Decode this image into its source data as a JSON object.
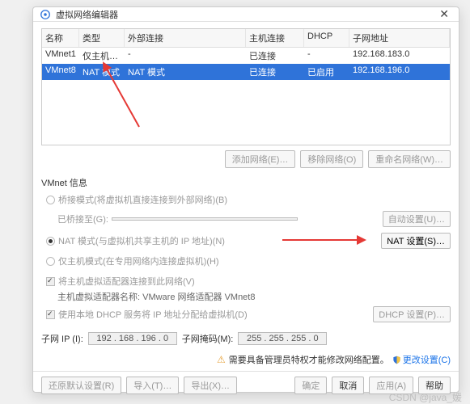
{
  "window": {
    "title": "虚拟网络编辑器"
  },
  "table": {
    "headers": {
      "name": "名称",
      "type": "类型",
      "ext": "外部连接",
      "host": "主机连接",
      "dhcp": "DHCP",
      "subnet": "子网地址"
    },
    "rows": [
      {
        "name": "VMnet1",
        "type": "仅主机…",
        "ext": "-",
        "host": "已连接",
        "dhcp": "-",
        "subnet": "192.168.183.0",
        "selected": false
      },
      {
        "name": "VMnet8",
        "type": "NAT 模式",
        "ext": "NAT 模式",
        "host": "已连接",
        "dhcp": "已启用",
        "subnet": "192.168.196.0",
        "selected": true
      }
    ]
  },
  "buttons": {
    "add_net": "添加网络(E)…",
    "remove_net": "移除网络(O)",
    "rename_net": "重命名网络(W)…",
    "auto_settings": "自动设置(U)…",
    "nat_settings": "NAT 设置(S)…",
    "dhcp_settings": "DHCP 设置(P)…",
    "restore": "还原默认设置(R)",
    "import": "导入(T)…",
    "export": "导出(X)…",
    "ok": "确定",
    "cancel": "取消",
    "apply": "应用(A)",
    "help": "帮助",
    "change_settings": "更改设置(C)"
  },
  "vmnet_info": {
    "title": "VMnet 信息",
    "bridge": "桥接模式(将虚拟机直接连接到外部网络)(B)",
    "bridge_to_label": "已桥接至(G):",
    "nat": "NAT 模式(与虚拟机共享主机的 IP 地址)(N)",
    "hostonly": "仅主机模式(在专用网络内连接虚拟机)(H)",
    "connect_host": "将主机虚拟适配器连接到此网络(V)",
    "adapter_name": "主机虚拟适配器名称: VMware 网络适配器 VMnet8",
    "use_dhcp": "使用本地 DHCP 服务将 IP 地址分配给虚拟机(D)",
    "subnet_ip_label": "子网 IP (I):",
    "subnet_ip": "192 . 168 . 196 .  0",
    "subnet_mask_label": "子网掩码(M):",
    "subnet_mask": "255 . 255 . 255 .  0"
  },
  "warning": "需要具备管理员特权才能修改网络配置。",
  "watermark": "CSDN @java_媛"
}
